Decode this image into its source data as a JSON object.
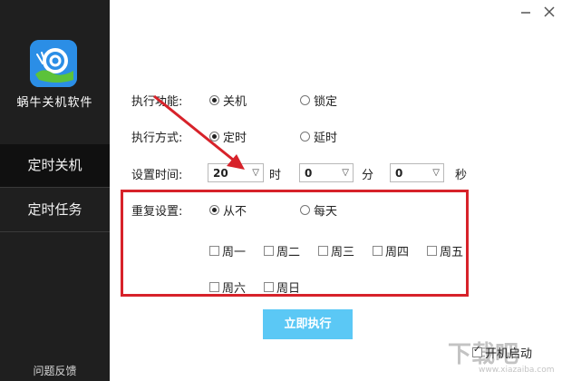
{
  "window": {
    "minimize_icon": "minimize-icon",
    "close_icon": "close-icon"
  },
  "sidebar": {
    "app_name": "蜗牛关机软件",
    "app_icon": "snail-icon",
    "items": [
      {
        "label": "定时关机",
        "active": true
      },
      {
        "label": "定时任务",
        "active": false
      }
    ],
    "feedback": "问题反馈"
  },
  "form": {
    "function_label": "执行功能:",
    "function_options": [
      {
        "label": "关机",
        "selected": true
      },
      {
        "label": "锁定",
        "selected": false
      }
    ],
    "mode_label": "执行方式:",
    "mode_options": [
      {
        "label": "定时",
        "selected": true
      },
      {
        "label": "延时",
        "selected": false
      }
    ],
    "time_label": "设置时间:",
    "hour_value": "20",
    "hour_unit": "时",
    "minute_value": "0",
    "minute_unit": "分",
    "second_value": "0",
    "second_unit": "秒",
    "repeat_label": "重复设置:",
    "repeat_options": [
      {
        "label": "从不",
        "selected": true
      },
      {
        "label": "每天",
        "selected": false
      }
    ],
    "weekdays": [
      {
        "label": "周一",
        "checked": false
      },
      {
        "label": "周二",
        "checked": false
      },
      {
        "label": "周三",
        "checked": false
      },
      {
        "label": "周四",
        "checked": false
      },
      {
        "label": "周五",
        "checked": false
      },
      {
        "label": "周六",
        "checked": false
      },
      {
        "label": "周日",
        "checked": false
      }
    ],
    "execute_button": "立即执行",
    "startup_label": "开机启动",
    "startup_checked": true
  },
  "watermark": {
    "logo": "下载吧",
    "url": "www.xiazaiba.com"
  },
  "colors": {
    "sidebar_bg": "#1f1f1f",
    "active_nav": "#101010",
    "button": "#5bc8f5",
    "highlight": "#d7222a"
  }
}
